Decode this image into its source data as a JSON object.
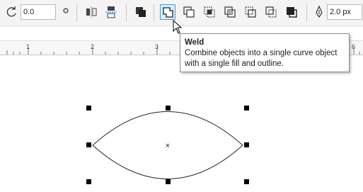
{
  "toolbar": {
    "rotation_value": "0.0",
    "outline_width_value": "2.0 px",
    "icons": [
      "rotate-icon",
      "degree-icon",
      "mirror-horizontal-icon",
      "mirror-vertical-icon",
      "arrange-icon",
      "weld-icon",
      "trim-icon",
      "intersect-icon",
      "simplify-icon",
      "front-minus-back-icon",
      "back-minus-front-icon",
      "create-boundary-icon",
      "outline-pen-icon"
    ]
  },
  "ruler": {
    "labels": [
      "1",
      "2",
      "3",
      "6"
    ]
  },
  "tooltip": {
    "title": "Weld",
    "description": "Combine objects into a single curve object with a single fill and outline."
  },
  "canvas": {
    "shape": "lens-shaped curve object",
    "center_marker": "×",
    "selection_handles": 8
  }
}
